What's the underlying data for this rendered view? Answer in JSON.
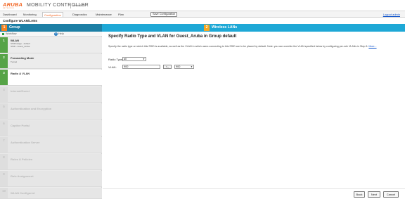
{
  "brand": {
    "logo_word": "ARUBA",
    "logo_sub": "NETWORKS",
    "title": "MOBILITY CONTROLLER",
    "model": "Aruba6000"
  },
  "nav": {
    "tabs": [
      "Dashboard",
      "Monitoring",
      "Configuration",
      "Diagnostics",
      "Maintenance",
      "Plan"
    ],
    "active_tab": "Configuration",
    "save_label": "Save Configuration",
    "logout_label": "Logout admin"
  },
  "page_title": "Configure WLAN/LANs",
  "wizard": {
    "group_step": "1",
    "group_label": "Group",
    "wlan_step": "2",
    "wlan_label": "Wireless LANs",
    "workflow_label": "Workflow",
    "help_label": "Help"
  },
  "workflow": [
    {
      "num": "1",
      "title": "WLAN",
      "detail_1": "SSID/usage - default",
      "detail_2": "SSID - Guest_Aruba",
      "state": "done"
    },
    {
      "num": "2",
      "title": "Forwarding Mode",
      "detail_1": "Tunnel",
      "state": "done"
    },
    {
      "num": "3",
      "title": "Radio & VLAN",
      "state": "current"
    },
    {
      "num": "4",
      "title": "Internal/Guest",
      "state": "pending"
    },
    {
      "num": "5",
      "title": "Authentication and Encryption",
      "state": "pending"
    },
    {
      "num": "6",
      "title": "Captive Portal",
      "state": "pending"
    },
    {
      "num": "7",
      "title": "Authentication Server",
      "state": "pending"
    },
    {
      "num": "8",
      "title": "Roles & Policies",
      "state": "pending"
    },
    {
      "num": "9",
      "title": "Role Assignment",
      "state": "pending"
    },
    {
      "num": "10",
      "title": "WLAN Configured",
      "state": "pending"
    }
  ],
  "main": {
    "heading": "Specify Radio Type and VLAN for Guest_Aruba in Group default",
    "description": "Specify the radio type on which this SSID is available, as well as the VLAN in which users connecting to this SSID are to be placed by default. Note: you can override the VLAN specified below by configuring per-role VLANs in Step 8.",
    "more_link": "More...",
    "radio_type_label": "Radio Type:",
    "radio_type_value": "all",
    "vlan_label": "VLAN:",
    "vlan_value": "900",
    "vlan_move_button": "<--",
    "vlan_select_value": "900"
  },
  "footer": {
    "back": "Back",
    "next": "Next",
    "cancel": "Cancel"
  },
  "colors": {
    "accent": "#f26522",
    "group_bar": "#1d7fa5",
    "wlan_bar": "#1ea8d6",
    "step_done": "#56a447",
    "step_badge": "#f5a623"
  }
}
